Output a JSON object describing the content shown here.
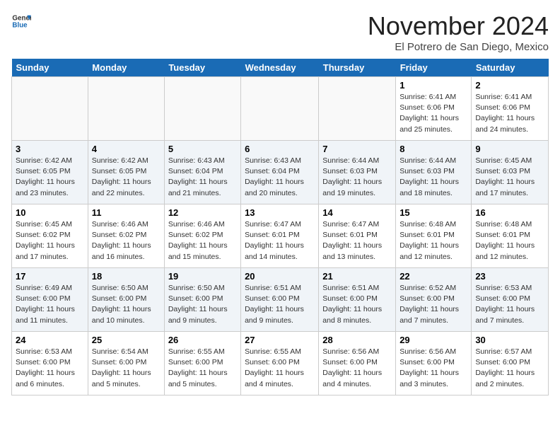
{
  "header": {
    "logo_general": "General",
    "logo_blue": "Blue",
    "month_title": "November 2024",
    "location": "El Potrero de San Diego, Mexico"
  },
  "days_of_week": [
    "Sunday",
    "Monday",
    "Tuesday",
    "Wednesday",
    "Thursday",
    "Friday",
    "Saturday"
  ],
  "weeks": [
    [
      {
        "day": "",
        "info": ""
      },
      {
        "day": "",
        "info": ""
      },
      {
        "day": "",
        "info": ""
      },
      {
        "day": "",
        "info": ""
      },
      {
        "day": "",
        "info": ""
      },
      {
        "day": "1",
        "info": "Sunrise: 6:41 AM\nSunset: 6:06 PM\nDaylight: 11 hours and 25 minutes."
      },
      {
        "day": "2",
        "info": "Sunrise: 6:41 AM\nSunset: 6:06 PM\nDaylight: 11 hours and 24 minutes."
      }
    ],
    [
      {
        "day": "3",
        "info": "Sunrise: 6:42 AM\nSunset: 6:05 PM\nDaylight: 11 hours and 23 minutes."
      },
      {
        "day": "4",
        "info": "Sunrise: 6:42 AM\nSunset: 6:05 PM\nDaylight: 11 hours and 22 minutes."
      },
      {
        "day": "5",
        "info": "Sunrise: 6:43 AM\nSunset: 6:04 PM\nDaylight: 11 hours and 21 minutes."
      },
      {
        "day": "6",
        "info": "Sunrise: 6:43 AM\nSunset: 6:04 PM\nDaylight: 11 hours and 20 minutes."
      },
      {
        "day": "7",
        "info": "Sunrise: 6:44 AM\nSunset: 6:03 PM\nDaylight: 11 hours and 19 minutes."
      },
      {
        "day": "8",
        "info": "Sunrise: 6:44 AM\nSunset: 6:03 PM\nDaylight: 11 hours and 18 minutes."
      },
      {
        "day": "9",
        "info": "Sunrise: 6:45 AM\nSunset: 6:03 PM\nDaylight: 11 hours and 17 minutes."
      }
    ],
    [
      {
        "day": "10",
        "info": "Sunrise: 6:45 AM\nSunset: 6:02 PM\nDaylight: 11 hours and 17 minutes."
      },
      {
        "day": "11",
        "info": "Sunrise: 6:46 AM\nSunset: 6:02 PM\nDaylight: 11 hours and 16 minutes."
      },
      {
        "day": "12",
        "info": "Sunrise: 6:46 AM\nSunset: 6:02 PM\nDaylight: 11 hours and 15 minutes."
      },
      {
        "day": "13",
        "info": "Sunrise: 6:47 AM\nSunset: 6:01 PM\nDaylight: 11 hours and 14 minutes."
      },
      {
        "day": "14",
        "info": "Sunrise: 6:47 AM\nSunset: 6:01 PM\nDaylight: 11 hours and 13 minutes."
      },
      {
        "day": "15",
        "info": "Sunrise: 6:48 AM\nSunset: 6:01 PM\nDaylight: 11 hours and 12 minutes."
      },
      {
        "day": "16",
        "info": "Sunrise: 6:48 AM\nSunset: 6:01 PM\nDaylight: 11 hours and 12 minutes."
      }
    ],
    [
      {
        "day": "17",
        "info": "Sunrise: 6:49 AM\nSunset: 6:00 PM\nDaylight: 11 hours and 11 minutes."
      },
      {
        "day": "18",
        "info": "Sunrise: 6:50 AM\nSunset: 6:00 PM\nDaylight: 11 hours and 10 minutes."
      },
      {
        "day": "19",
        "info": "Sunrise: 6:50 AM\nSunset: 6:00 PM\nDaylight: 11 hours and 9 minutes."
      },
      {
        "day": "20",
        "info": "Sunrise: 6:51 AM\nSunset: 6:00 PM\nDaylight: 11 hours and 9 minutes."
      },
      {
        "day": "21",
        "info": "Sunrise: 6:51 AM\nSunset: 6:00 PM\nDaylight: 11 hours and 8 minutes."
      },
      {
        "day": "22",
        "info": "Sunrise: 6:52 AM\nSunset: 6:00 PM\nDaylight: 11 hours and 7 minutes."
      },
      {
        "day": "23",
        "info": "Sunrise: 6:53 AM\nSunset: 6:00 PM\nDaylight: 11 hours and 7 minutes."
      }
    ],
    [
      {
        "day": "24",
        "info": "Sunrise: 6:53 AM\nSunset: 6:00 PM\nDaylight: 11 hours and 6 minutes."
      },
      {
        "day": "25",
        "info": "Sunrise: 6:54 AM\nSunset: 6:00 PM\nDaylight: 11 hours and 5 minutes."
      },
      {
        "day": "26",
        "info": "Sunrise: 6:55 AM\nSunset: 6:00 PM\nDaylight: 11 hours and 5 minutes."
      },
      {
        "day": "27",
        "info": "Sunrise: 6:55 AM\nSunset: 6:00 PM\nDaylight: 11 hours and 4 minutes."
      },
      {
        "day": "28",
        "info": "Sunrise: 6:56 AM\nSunset: 6:00 PM\nDaylight: 11 hours and 4 minutes."
      },
      {
        "day": "29",
        "info": "Sunrise: 6:56 AM\nSunset: 6:00 PM\nDaylight: 11 hours and 3 minutes."
      },
      {
        "day": "30",
        "info": "Sunrise: 6:57 AM\nSunset: 6:00 PM\nDaylight: 11 hours and 2 minutes."
      }
    ]
  ]
}
